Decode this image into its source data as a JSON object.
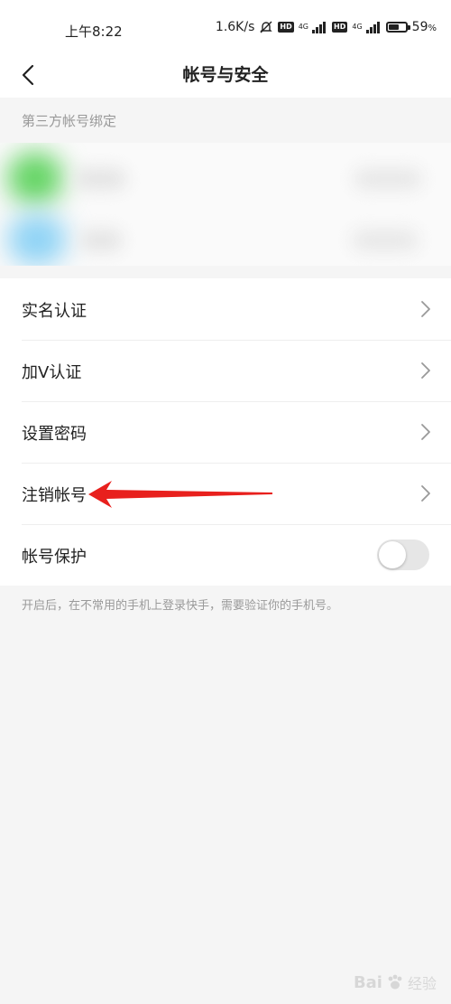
{
  "status_bar": {
    "time": "上午8:22",
    "speed": "1.6K/s",
    "hd1": "HD",
    "net1": "4G",
    "hd2": "HD",
    "net2": "4G",
    "battery_percent": "59",
    "battery_unit": "%",
    "battery_level": 0.59
  },
  "nav": {
    "title": "帐号与安全",
    "back_icon": "chevron-left-icon"
  },
  "third_party": {
    "header": "第三方帐号绑定"
  },
  "menu": [
    {
      "label": "实名认证",
      "type": "link"
    },
    {
      "label": "加V认证",
      "type": "link"
    },
    {
      "label": "设置密码",
      "type": "link"
    },
    {
      "label": "注销帐号",
      "type": "link"
    },
    {
      "label": "帐号保护",
      "type": "toggle",
      "enabled": false
    }
  ],
  "footnote": "开启后，在不常用的手机上登录快手，需要验证你的手机号。",
  "colors": {
    "annotation_arrow": "#e8201d",
    "toggle_off": "#e6e6e6",
    "background": "#f5f5f5"
  },
  "watermark": {
    "brand": "Bai",
    "sub": "经验"
  }
}
